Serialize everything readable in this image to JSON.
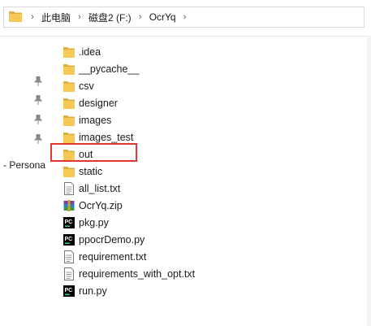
{
  "address_bar": {
    "crumbs": [
      "此电脑",
      "磁盘2 (F:)",
      "OcrYq"
    ]
  },
  "sidebar": {
    "label": "- Persona"
  },
  "files": [
    {
      "name": ".idea",
      "type": "folder"
    },
    {
      "name": "__pycache__",
      "type": "folder"
    },
    {
      "name": "csv",
      "type": "folder"
    },
    {
      "name": "designer",
      "type": "folder"
    },
    {
      "name": "images",
      "type": "folder"
    },
    {
      "name": "images_test",
      "type": "folder"
    },
    {
      "name": "out",
      "type": "folder"
    },
    {
      "name": "static",
      "type": "folder"
    },
    {
      "name": "all_list.txt",
      "type": "text"
    },
    {
      "name": "OcrYq.zip",
      "type": "zip"
    },
    {
      "name": "pkg.py",
      "type": "pycharm"
    },
    {
      "name": "ppocrDemo.py",
      "type": "pycharm"
    },
    {
      "name": "requirement.txt",
      "type": "text"
    },
    {
      "name": "requirements_with_opt.txt",
      "type": "text"
    },
    {
      "name": "run.py",
      "type": "pycharm"
    }
  ],
  "highlighted_item": "out",
  "colors": {
    "folder": "#f6c957",
    "highlight_border": "#e0362f",
    "pycharm_bg": "#000000",
    "pycharm_accent": "#21d789"
  }
}
